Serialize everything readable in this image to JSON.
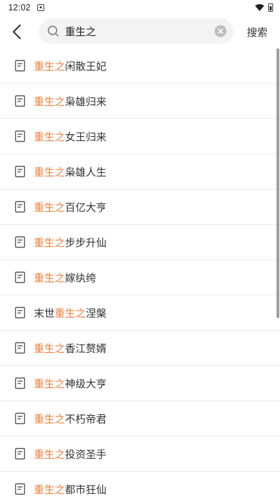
{
  "status_bar": {
    "time": "12:02"
  },
  "search": {
    "query": "重生之",
    "submit_label": "搜索"
  },
  "colors": {
    "highlight": "#f07f3c",
    "text": "#333333",
    "search_bg": "#f3f3f3"
  },
  "results": [
    {
      "pre": "",
      "match": "重生之",
      "post": "闲散王妃"
    },
    {
      "pre": "",
      "match": "重生之",
      "post": "枭雄归来"
    },
    {
      "pre": "",
      "match": "重生之",
      "post": "女王归来"
    },
    {
      "pre": "",
      "match": "重生之",
      "post": "枭雄人生"
    },
    {
      "pre": "",
      "match": "重生之",
      "post": "百亿大亨"
    },
    {
      "pre": "",
      "match": "重生之",
      "post": "步步升仙"
    },
    {
      "pre": "",
      "match": "重生之",
      "post": "嫁纨绔"
    },
    {
      "pre": "末世",
      "match": "重生之",
      "post": "涅槃"
    },
    {
      "pre": "",
      "match": "重生之",
      "post": "香江赘婿"
    },
    {
      "pre": "",
      "match": "重生之",
      "post": "神级大亨"
    },
    {
      "pre": "",
      "match": "重生之",
      "post": "不朽帝君"
    },
    {
      "pre": "",
      "match": "重生之",
      "post": "投资圣手"
    },
    {
      "pre": "",
      "match": "重生之",
      "post": "都市狂仙"
    }
  ]
}
